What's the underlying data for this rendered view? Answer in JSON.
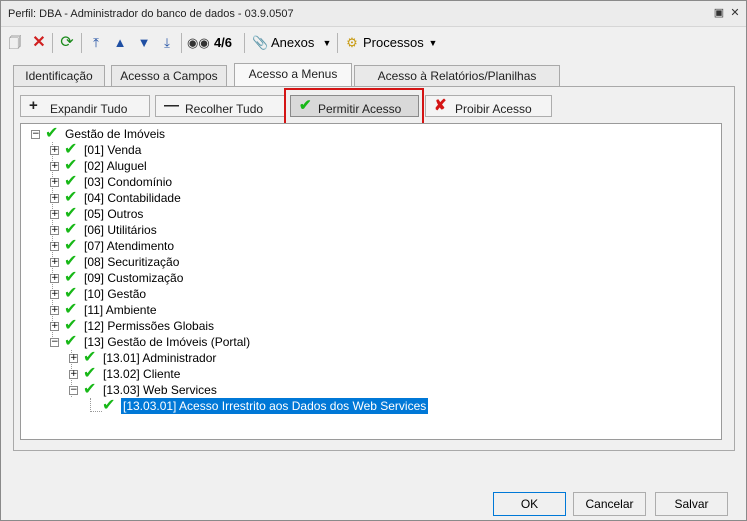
{
  "window": {
    "title": "Perfil: DBA - Administrador do banco de dados - 03.9.0507"
  },
  "toolbar": {
    "record_counter": "4/6",
    "anexos_label": "Anexos",
    "processos_label": "Processos"
  },
  "tabs": [
    {
      "label": "Identificação"
    },
    {
      "label": "Acesso a Campos"
    },
    {
      "label": "Acesso a Menus"
    },
    {
      "label": "Acesso à Relatórios/Planilhas"
    }
  ],
  "actions": {
    "expand_all": "Expandir Tudo",
    "collapse_all": "Recolher Tudo",
    "allow_access": "Permitir Acesso",
    "deny_access": "Proibir Acesso"
  },
  "tree": {
    "root": "Gestão de Imóveis",
    "items": [
      "[01] Venda",
      "[02] Aluguel",
      "[03] Condomínio",
      "[04] Contabilidade",
      "[05] Outros",
      "[06] Utilitários",
      "[07] Atendimento",
      "[08] Securitização",
      "[09] Customização",
      "[10] Gestão",
      "[11] Ambiente",
      "[12] Permissões Globais",
      "[13] Gestão de Imóveis (Portal)"
    ],
    "portal_children": [
      "[13.01] Administrador",
      "[13.02] Cliente",
      "[13.03] Web Services"
    ],
    "selected_leaf": "[13.03.01] Acesso Irrestrito aos Dados dos Web Services"
  },
  "buttons": {
    "ok": "OK",
    "cancel": "Cancelar",
    "save": "Salvar"
  }
}
